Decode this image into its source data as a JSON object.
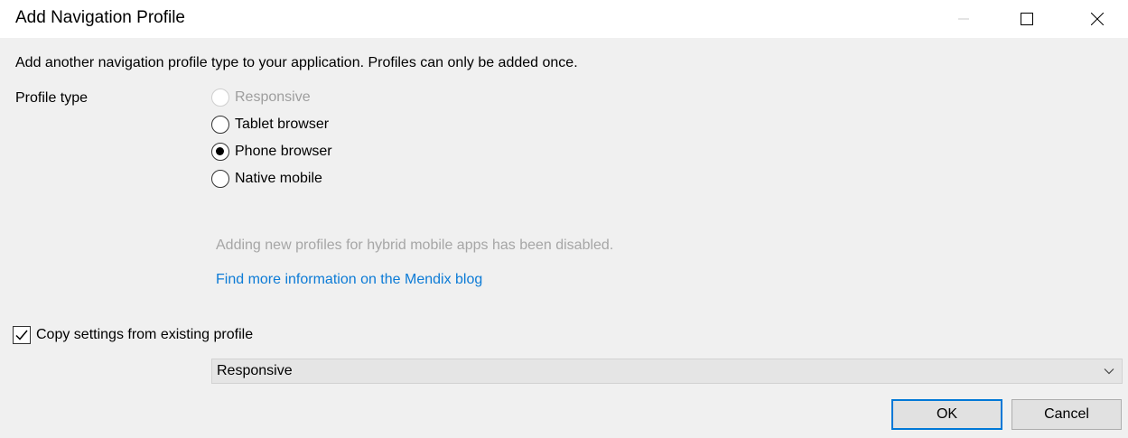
{
  "window": {
    "title": "Add Navigation Profile"
  },
  "description": "Add another navigation profile type to your application. Profiles can only be added once.",
  "profile_type": {
    "label": "Profile type",
    "options": [
      {
        "label": "Responsive",
        "selected": false,
        "disabled": true
      },
      {
        "label": "Tablet browser",
        "selected": false,
        "disabled": false
      },
      {
        "label": "Phone browser",
        "selected": true,
        "disabled": false
      },
      {
        "label": "Native mobile",
        "selected": false,
        "disabled": false
      }
    ]
  },
  "note": "Adding new profiles for hybrid mobile apps has been disabled.",
  "link": "Find more information on the Mendix blog",
  "copy_settings": {
    "label": "Copy settings from existing profile",
    "checked": true,
    "selected_profile": "Responsive"
  },
  "buttons": {
    "ok": "OK",
    "cancel": "Cancel"
  },
  "colors": {
    "accent": "#0078d7",
    "link": "#0c7bd6",
    "disabled_text": "#a6a6a6",
    "client_bg": "#f0f0f0"
  }
}
